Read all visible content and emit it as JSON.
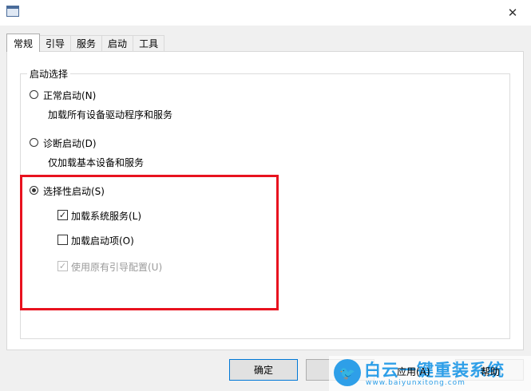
{
  "window": {
    "icon": "msconfig-icon",
    "close_glyph": "✕"
  },
  "tabs": [
    {
      "label": "常规",
      "active": true
    },
    {
      "label": "引导",
      "active": false
    },
    {
      "label": "服务",
      "active": false
    },
    {
      "label": "启动",
      "active": false
    },
    {
      "label": "工具",
      "active": false
    }
  ],
  "startup_group": {
    "title": "启动选择",
    "normal": {
      "label": "正常启动(N)",
      "description": "加载所有设备驱动程序和服务",
      "selected": false
    },
    "diagnostic": {
      "label": "诊断启动(D)",
      "description": "仅加载基本设备和服务",
      "selected": false
    },
    "selective": {
      "label": "选择性启动(S)",
      "selected": true,
      "options": {
        "load_services": {
          "label": "加载系统服务(L)",
          "checked": true,
          "enabled": true
        },
        "load_startup": {
          "label": "加载启动项(O)",
          "checked": false,
          "enabled": true
        },
        "use_boot_config": {
          "label": "使用原有引导配置(U)",
          "checked": true,
          "enabled": false
        }
      }
    }
  },
  "buttons": {
    "ok": "确定",
    "apply": "应用(A)",
    "help": "帮助"
  },
  "watermark": {
    "title": "白云一键重装系统",
    "url": "www.baiyunxitong.com",
    "bird_icon": "twitter-bird-icon"
  },
  "colors": {
    "highlight": "#e8121f",
    "watermark": "#2e9fe8",
    "primary_border": "#0078d7"
  }
}
